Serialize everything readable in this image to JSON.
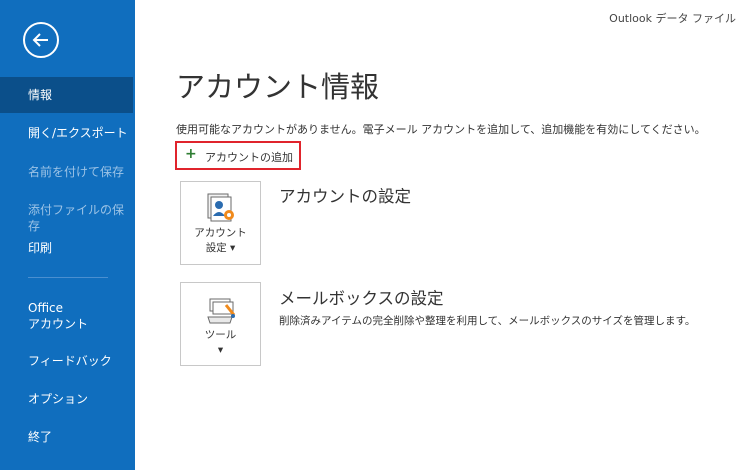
{
  "window_title": "Outlook データ ファイル",
  "sidebar": {
    "items": [
      {
        "label": "情報"
      },
      {
        "label": "開く/エクスポート"
      },
      {
        "label": "名前を付けて保存"
      },
      {
        "label": "添付ファイルの保存"
      },
      {
        "label": "印刷"
      },
      {
        "label": "Office"
      },
      {
        "label": "アカウント"
      },
      {
        "label": "フィードバック"
      },
      {
        "label": "オプション"
      },
      {
        "label": "終了"
      }
    ]
  },
  "main": {
    "title": "アカウント情報",
    "description": "使用可能なアカウントがありません。電子メール アカウントを追加して、追加機能を有効にしてください。",
    "add_account_label": "アカウントの追加",
    "account_settings": {
      "tile_line1": "アカウント",
      "tile_line2": "設定 ▾",
      "title": "アカウントの設定"
    },
    "mailbox_settings": {
      "tile_line1": "ツール",
      "tile_line2": "▾",
      "title": "メールボックスの設定",
      "description": "削除済みアイテムの完全削除や整理を利用して、メールボックスのサイズを管理します。"
    }
  },
  "colors": {
    "sidebar": "#106ebe",
    "active_item": "#0b4f8a",
    "highlight_border": "#e0242c"
  }
}
